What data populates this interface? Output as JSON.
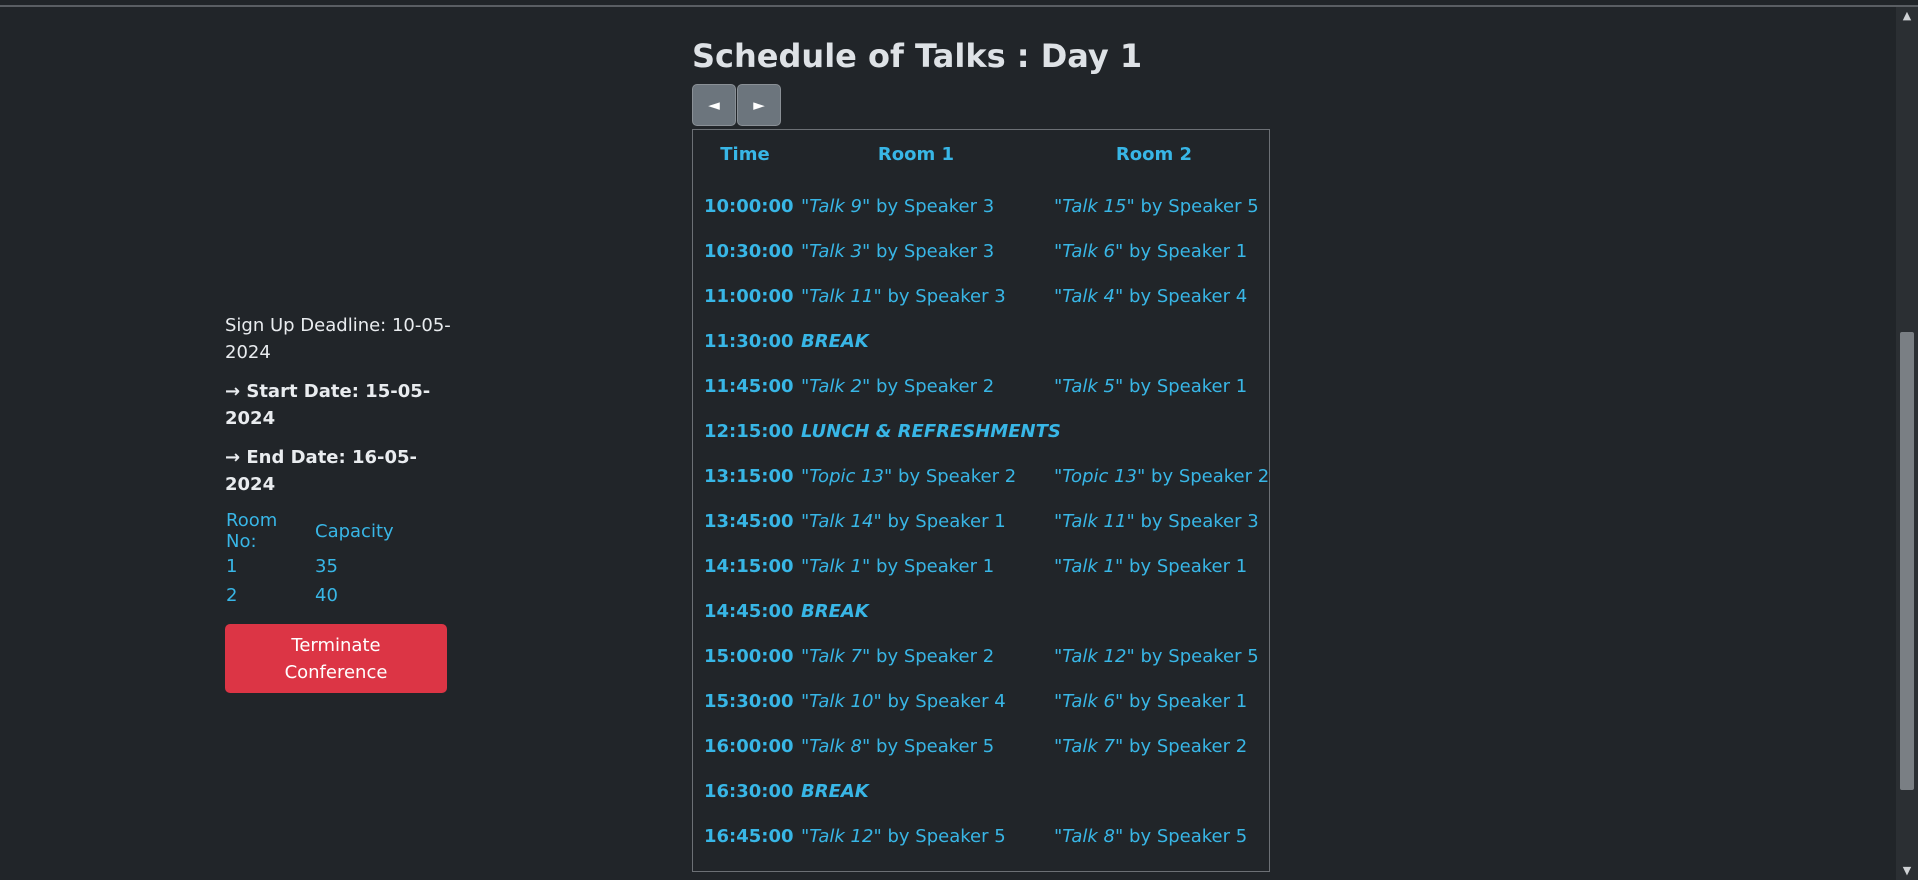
{
  "page": {
    "title": "Schedule of Talks : Day 1",
    "nav_prev": "◄",
    "nav_next": "►"
  },
  "sidebar": {
    "signup_deadline": "Sign Up Deadline: 10-05-2024",
    "start_date": "→ Start Date: 15-05-2024",
    "end_date": "→ End Date: 16-05-2024",
    "room_header": [
      "Room No:",
      "Capacity"
    ],
    "rooms": [
      {
        "no": "1",
        "capacity": "35"
      },
      {
        "no": "2",
        "capacity": "40"
      }
    ],
    "terminate_label": "Terminate Conference"
  },
  "schedule": {
    "headers": [
      "Time",
      "Room 1",
      "Room 2"
    ],
    "rows": [
      {
        "time": "10:00:00",
        "r1_talk": "\"Talk 9\"",
        "r1_speaker": " by Speaker 3",
        "r2_talk": "\"Talk 15\"",
        "r2_speaker": " by Speaker 5"
      },
      {
        "time": "10:30:00",
        "r1_talk": "\"Talk 3\"",
        "r1_speaker": " by Speaker 3",
        "r2_talk": "\"Talk 6\"",
        "r2_speaker": " by Speaker 1"
      },
      {
        "time": "11:00:00",
        "r1_talk": "\"Talk 11\"",
        "r1_speaker": " by Speaker 3",
        "r2_talk": "\"Talk 4\"",
        "r2_speaker": " by Speaker 4"
      },
      {
        "time": "11:30:00",
        "special": "BREAK"
      },
      {
        "time": "11:45:00",
        "r1_talk": "\"Talk 2\"",
        "r1_speaker": " by Speaker 2",
        "r2_talk": "\"Talk 5\"",
        "r2_speaker": " by Speaker 1"
      },
      {
        "time": "12:15:00",
        "special": "LUNCH & REFRESHMENTS"
      },
      {
        "time": "13:15:00",
        "r1_talk": "\"Topic 13\"",
        "r1_speaker": " by Speaker 2",
        "r2_talk": "\"Topic 13\"",
        "r2_speaker": " by Speaker 2"
      },
      {
        "time": "13:45:00",
        "r1_talk": "\"Talk 14\"",
        "r1_speaker": " by Speaker 1",
        "r2_talk": "\"Talk 11\"",
        "r2_speaker": " by Speaker 3"
      },
      {
        "time": "14:15:00",
        "r1_talk": "\"Talk 1\"",
        "r1_speaker": " by Speaker 1",
        "r2_talk": "\"Talk 1\"",
        "r2_speaker": " by Speaker 1"
      },
      {
        "time": "14:45:00",
        "special": "BREAK"
      },
      {
        "time": "15:00:00",
        "r1_talk": "\"Talk 7\"",
        "r1_speaker": " by Speaker 2",
        "r2_talk": "\"Talk 12\"",
        "r2_speaker": " by Speaker 5"
      },
      {
        "time": "15:30:00",
        "r1_talk": "\"Talk 10\"",
        "r1_speaker": " by Speaker 4",
        "r2_talk": "\"Talk 6\"",
        "r2_speaker": " by Speaker 1"
      },
      {
        "time": "16:00:00",
        "r1_talk": "\"Talk 8\"",
        "r1_speaker": " by Speaker 5",
        "r2_talk": "\"Talk 7\"",
        "r2_speaker": " by Speaker 2"
      },
      {
        "time": "16:30:00",
        "special": "BREAK"
      },
      {
        "time": "16:45:00",
        "r1_talk": "\"Talk 12\"",
        "r1_speaker": " by Speaker 5",
        "r2_talk": "\"Talk 8\"",
        "r2_speaker": " by Speaker 5"
      }
    ]
  },
  "scrollbar": {
    "up_icon": "▲",
    "down_icon": "▼"
  },
  "colors": {
    "background": "#212529",
    "accent": "#38b6e6",
    "danger": "#dc3545",
    "nav_button": "#6c757d"
  }
}
